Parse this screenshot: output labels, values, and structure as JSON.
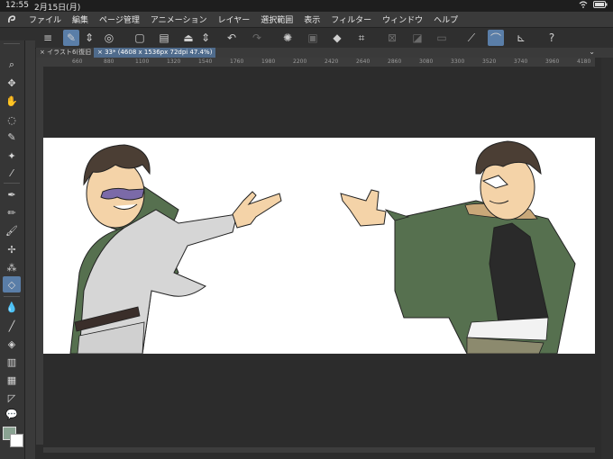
{
  "status": {
    "time": "12:55",
    "date": "2月15日(月)",
    "battery": "battery-icon",
    "wifi": "wifi-icon"
  },
  "menu": {
    "items": [
      "ファイル",
      "編集",
      "ページ管理",
      "アニメーション",
      "レイヤー",
      "選択範囲",
      "表示",
      "フィルター",
      "ウィンドウ",
      "ヘルプ"
    ]
  },
  "tabs": [
    {
      "label": "イラスト6(復旧"
    },
    {
      "label": "33* (4608 x 1536px 72dpi 47.4%)"
    }
  ],
  "ruler": {
    "ticks": [
      "660",
      "880",
      "1100",
      "1320",
      "1540",
      "1760",
      "1980",
      "2200",
      "2420",
      "2640",
      "2860",
      "3080",
      "3300",
      "3520",
      "3740",
      "3960",
      "4180"
    ]
  },
  "colors": {
    "accent": "#5a7ea8",
    "main_color": "#8aa392",
    "sub_color": "#ffffff"
  }
}
